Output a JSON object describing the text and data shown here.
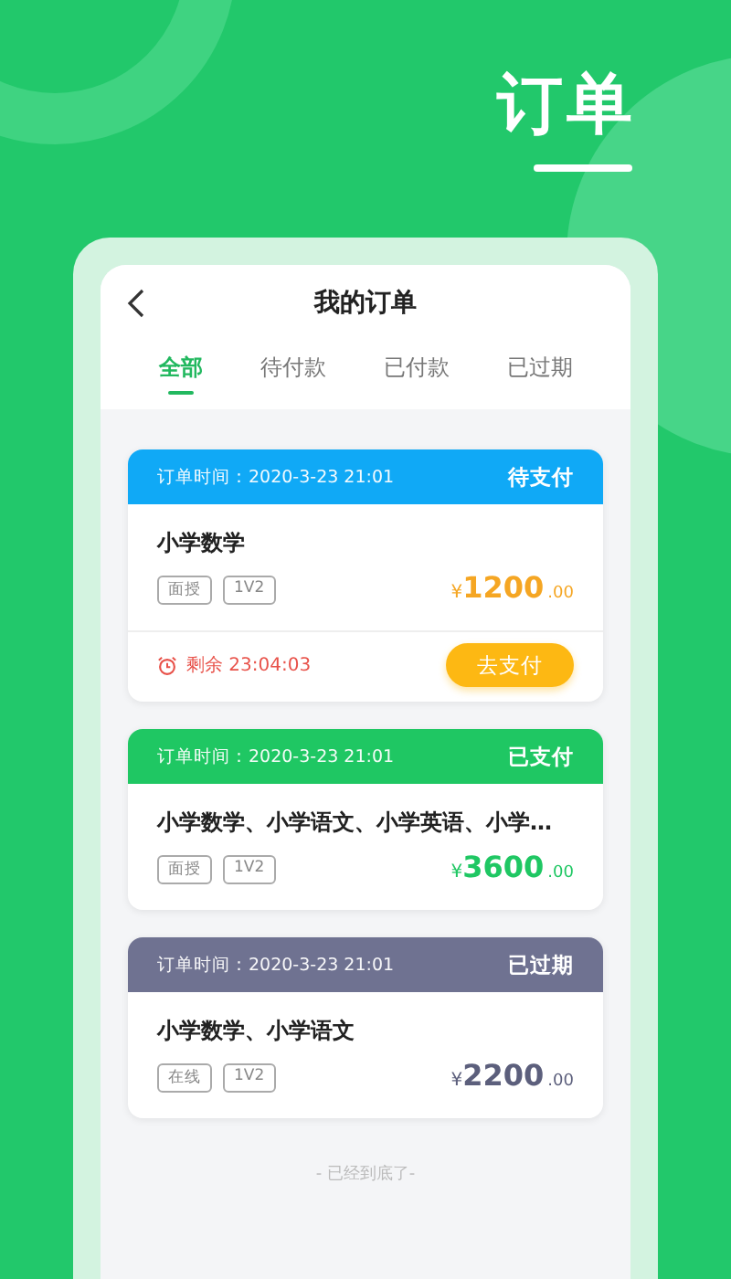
{
  "banner": {
    "title": "订单"
  },
  "nav": {
    "title": "我的订单"
  },
  "tabs": [
    {
      "label": "全部",
      "selected": true
    },
    {
      "label": "待付款",
      "selected": false
    },
    {
      "label": "已付款",
      "selected": false
    },
    {
      "label": "已过期",
      "selected": false
    }
  ],
  "orders": [
    {
      "kind": "pending",
      "time": "订单时间：2020-3-23  21:01",
      "status": "待支付",
      "title": "小学数学",
      "tags": [
        "面授",
        "1V2"
      ],
      "currency": "¥",
      "amount": "1200",
      "cents": ".00",
      "countdown": "剩余  23:04:03",
      "action": "去支付"
    },
    {
      "kind": "paid",
      "time": "订单时间：2020-3-23  21:01",
      "status": "已支付",
      "title": "小学数学、小学语文、小学英语、小学…",
      "tags": [
        "面授",
        "1V2"
      ],
      "currency": "¥",
      "amount": "3600",
      "cents": ".00"
    },
    {
      "kind": "expired",
      "time": "订单时间：2020-3-23  21:01",
      "status": "已过期",
      "title": "小学数学、小学语文",
      "tags": [
        "在线",
        "1V2"
      ],
      "currency": "¥",
      "amount": "2200",
      "cents": ".00"
    }
  ],
  "end_note": "- 已经到底了-"
}
